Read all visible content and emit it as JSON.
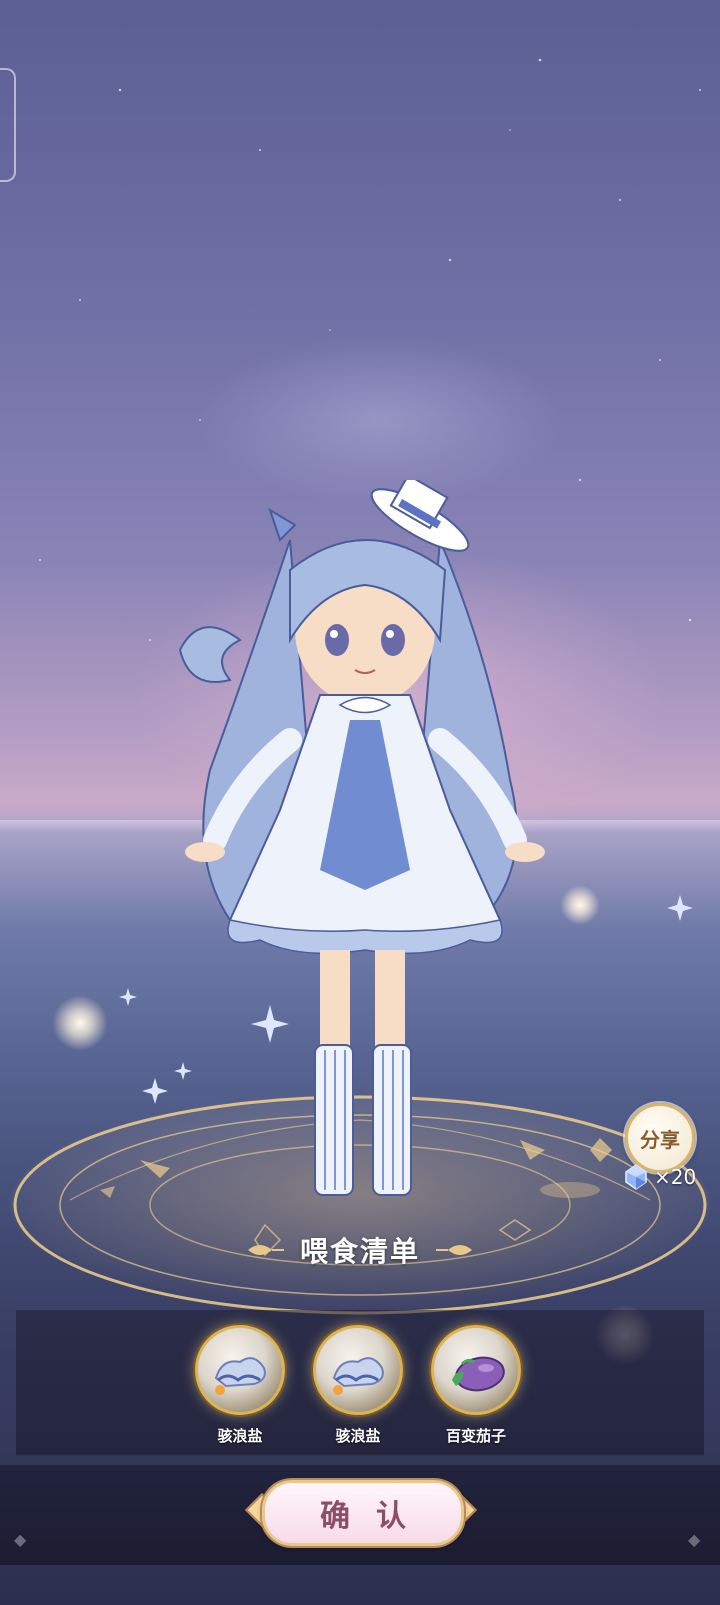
{
  "share": {
    "label": "分享"
  },
  "reward": {
    "icon": "crystal-gem-icon",
    "count": "×20"
  },
  "feed_list": {
    "title": "喂食清单",
    "items": [
      {
        "name": "骇浪盐",
        "icon": "salt-wave-icon"
      },
      {
        "name": "骇浪盐",
        "icon": "salt-wave-icon"
      },
      {
        "name": "百变茄子",
        "icon": "eggplant-icon"
      }
    ]
  },
  "confirm": {
    "label": "确认"
  },
  "colors": {
    "accent_gold": "#d9b45a",
    "button_text": "#8c4e63"
  }
}
